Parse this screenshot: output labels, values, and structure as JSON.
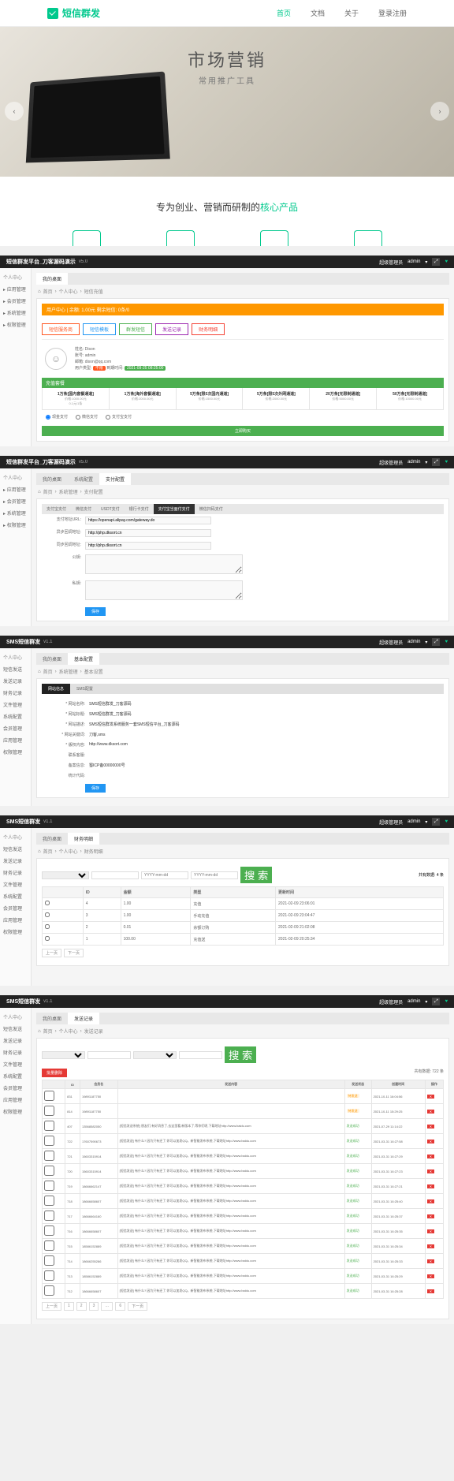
{
  "top": {
    "logo": "短信群发",
    "nav": [
      "首页",
      "文档",
      "关于",
      "登录注册"
    ],
    "hero_title": "市场营销",
    "hero_sub": "常用推广工具",
    "tagline_pre": "专为创业、营销而研制的",
    "tagline_green": "核心产品"
  },
  "admin": {
    "title1": "短信群发平台_刀客源码演示",
    "title2": "SMS短信群发",
    "ver1": "v5.0",
    "ver2": "v1.1",
    "role": "超级管理员",
    "user": "admin"
  },
  "sidebar1": {
    "top": "个人中心",
    "items": [
      "应用管理",
      "会员管理",
      "系统管理",
      "权限管理"
    ]
  },
  "sidebar2": {
    "top": "个人中心",
    "items": [
      "短信发送",
      "发送记录",
      "财务记录",
      "文件管理",
      "系统配置",
      "会员管理",
      "应用管理",
      "权限管理"
    ]
  },
  "p1": {
    "tabs": [
      "我的桌面"
    ],
    "crumb": [
      "首页",
      "个人中心",
      "短信充值"
    ],
    "balance": "用户中心 | 余额: 1.00元 剩余短信: 0条/0",
    "rtabs": [
      "短信服务商",
      "短信模板",
      "群发短信",
      "发送记录",
      "财务明细"
    ],
    "profile": {
      "name": "姓名: Dison",
      "account": "账号: admin",
      "mail": "邮箱: dison@qq.com",
      "type_lbl": "用户类型:",
      "type": "不限",
      "time_lbl": "到期时间:",
      "time": "2021-09-25 08:25:00"
    },
    "pkg_header": "充值套餐",
    "packages": [
      {
        "name": "1万条[国内套餐通道]",
        "price": "价格:1000.00元",
        "mark": "0.1元/1条"
      },
      {
        "name": "1万条[海外套餐通道]",
        "price": "价格:2000.00元",
        "mark": ""
      },
      {
        "name": "5万条[限5次国内通道]",
        "price": "价格:1500.00元",
        "mark": ""
      },
      {
        "name": "5万条[限5次外网通道]",
        "price": "价格:2000.00元",
        "mark": ""
      },
      {
        "name": "20万条[无限制通道]",
        "price": "价格:5000.00元",
        "mark": ""
      },
      {
        "name": "50万条[无限制通道]",
        "price": "价格:10000.00元",
        "mark": ""
      }
    ],
    "pay_opts": [
      "现金支付",
      "微信支付",
      "支付宝支付"
    ],
    "submit": "立即购买"
  },
  "p2": {
    "tabs": [
      "我的桌面",
      "系统配置",
      "支付配置"
    ],
    "crumb": [
      "首页",
      "系统管理",
      "支付配置"
    ],
    "subtabs": [
      "支付宝支付",
      "微信支付",
      "USDT支付",
      "银行卡支付",
      "支付宝当面付支付",
      "微信扫码支付"
    ],
    "active_tab": "支付宝当面付支付",
    "rows": [
      {
        "lbl": "支付地址URL:",
        "val": "https://openapi.alipay.com/gateway.do"
      },
      {
        "lbl": "异步回调地址:",
        "val": "http://php.dksort.cn"
      },
      {
        "lbl": "同步回调地址:",
        "val": "http://php.dksort.cn"
      },
      {
        "lbl": "公钥:",
        "ta": true
      },
      {
        "lbl": "私钥:",
        "ta": true
      }
    ],
    "save": "保存"
  },
  "p3": {
    "tabs": [
      "我的桌面",
      "基本配置"
    ],
    "crumb": [
      "首页",
      "系统管理",
      "基本设置"
    ],
    "subtabs": [
      "网站信息",
      "SMS配置"
    ],
    "rows": [
      {
        "lbl": "* 网站名称:",
        "val": "SMS短信群发_刀客源码"
      },
      {
        "lbl": "* 网站标题:",
        "val": "SMS短信群发_刀客源码"
      },
      {
        "lbl": "* 网站描述:",
        "val": "SMS短信群发系统服务一套SMS短信平台_刀客源码"
      },
      {
        "lbl": "* 网站关键词:",
        "val": "刀客,sms"
      },
      {
        "lbl": "* 版权内容:",
        "val": "http://www.dksort.com"
      },
      {
        "lbl": "联系客服:",
        "val": ""
      },
      {
        "lbl": "备案信息:",
        "val": "蜀ICP备00000000号"
      },
      {
        "lbl": "统计代码:",
        "val": "",
        "ta": true
      }
    ],
    "save": "保存"
  },
  "p4": {
    "tabs": [
      "我的桌面",
      "财务明细"
    ],
    "crumb": [
      "首页",
      "个人中心",
      "财务明细"
    ],
    "search_btn": "搜 索",
    "total_lbl": "共有数据:",
    "total": "4 条",
    "headers": [
      "",
      "ID",
      "金额",
      "类型",
      "更新时间"
    ],
    "rows": [
      {
        "id": "4",
        "amt": "1.00",
        "type": "充值",
        "time": "2021-02-09 23:06:01"
      },
      {
        "id": "3",
        "amt": "1.00",
        "type": "手动充值",
        "time": "2021-02-09 23:04:47"
      },
      {
        "id": "2",
        "amt": "0.01",
        "type": "余额订购",
        "time": "2021-02-09 21:02:08"
      },
      {
        "id": "1",
        "amt": "100.00",
        "type": "充值送",
        "time": "2021-02-09 20:25:34"
      }
    ],
    "pager": [
      "上一页",
      "下一页"
    ]
  },
  "p5": {
    "tabs": [
      "我的桌面",
      "发送记录"
    ],
    "crumb": [
      "首页",
      "个人中心",
      "发送记录"
    ],
    "search_btn": "搜 索",
    "del_btn": "批量删除",
    "total_lbl": "共有数据:",
    "total": "722 条",
    "headers": [
      "",
      "ID",
      "会员名",
      "发送内容",
      "发送状态",
      "创建时间",
      "操作"
    ],
    "rows": [
      {
        "id": "831",
        "name": "19891187750",
        "content": "",
        "status": "待发送",
        "time": "2021-10-11 16:04:56"
      },
      {
        "id": "814",
        "name": "19891187750",
        "content": "",
        "status": "待发送",
        "time": "2021-10-11 15:29:25"
      },
      {
        "id": "407",
        "name": "13568582050",
        "content": "[短信发送系统] 朋友们,有好消息了,去这里看,新版本了,等你们呢,下载地址http://www.baidu.com",
        "status": "发送成功",
        "time": "2021-07-29 11:14:22"
      },
      {
        "id": "722",
        "name": "17607590673",
        "content": "[短信发送] 有什么? 因为只有还了,你可以加发QQ。新智能发布系统,下载地址http://www.baidu.com",
        "status": "发送成功",
        "time": "2021-03-31 16:27:58"
      },
      {
        "id": "721",
        "name": "15603315914",
        "content": "[短信发送] 有什么? 因为只有还了,你可以加发QQ。新智能发布系统,下载地址http://www.baidu.com",
        "status": "发送成功",
        "time": "2021-03-31 16:27:29"
      },
      {
        "id": "720",
        "name": "15603315914",
        "content": "[短信发送] 有什么? 因为只有还了,你可以加发QQ。新智能发布系统,下载地址http://www.baidu.com",
        "status": "发送成功",
        "time": "2021-03-31 16:27:23"
      },
      {
        "id": "719",
        "name": "18666662147",
        "content": "[短信发送] 有什么? 因为只有还了,你可以加发QQ。新智能发布系统,下载地址http://www.baidu.com",
        "status": "发送成功",
        "time": "2021-03-31 16:27:21"
      },
      {
        "id": "718",
        "name": "18666658607",
        "content": "[短信发送] 有什么? 因为只有还了,你可以加发QQ。新智能发布系统,下载地址http://www.baidu.com",
        "status": "发送成功",
        "time": "2021-03-31 16:25:40"
      },
      {
        "id": "717",
        "name": "18666664160",
        "content": "[短信发送] 有什么? 因为只有还了,你可以加发QQ。新智能发布系统,下载地址http://www.baidu.com",
        "status": "发送成功",
        "time": "2021-03-31 16:25:37"
      },
      {
        "id": "716",
        "name": "18666658607",
        "content": "[短信发送] 有什么? 因为只有还了,你可以加发QQ。新智能发布系统,下载地址http://www.baidu.com",
        "status": "发送成功",
        "time": "2021-03-31 16:25:35"
      },
      {
        "id": "715",
        "name": "18586152889",
        "content": "[短信发送] 有什么? 因为只有还了,你可以加发QQ。新智能发布系统,下载地址http://www.baidu.com",
        "status": "发送成功",
        "time": "2021-03-31 16:25:34"
      },
      {
        "id": "714",
        "name": "18666255286",
        "content": "[短信发送] 有什么? 因为只有还了,你可以加发QQ。新智能发布系统,下载地址http://www.baidu.com",
        "status": "发送成功",
        "time": "2021-03-31 16:25:33"
      },
      {
        "id": "713",
        "name": "18586152889",
        "content": "[短信发送] 有什么? 因为只有还了,你可以加发QQ。新智能发布系统,下载地址http://www.baidu.com",
        "status": "发送成功",
        "time": "2021-03-31 16:25:29"
      },
      {
        "id": "712",
        "name": "18666658607",
        "content": "[短信发送] 有什么? 因为只有还了,你可以加发QQ。新智能发布系统,下载地址http://www.baidu.com",
        "status": "发送成功",
        "time": "2021-03-31 16:25:28"
      }
    ],
    "pager": [
      "上一页",
      "1",
      "2",
      "3",
      "…",
      "6",
      "下一页"
    ]
  }
}
